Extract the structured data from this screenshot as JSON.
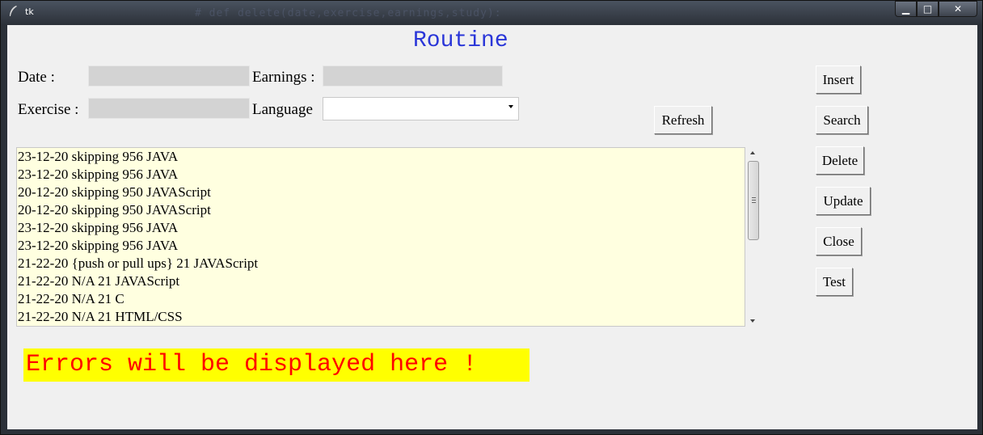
{
  "window": {
    "title": "tk",
    "background_hint": "# def delete(date,exercise,earnings,study):",
    "controls": {
      "minimize": "▁",
      "maximize": "□",
      "close": "✕"
    }
  },
  "app": {
    "heading": "Routine",
    "form": {
      "date_label": "Date :",
      "date_value": "",
      "earnings_label": "Earnings :",
      "earnings_value": "",
      "exercise_label": "Exercise :",
      "exercise_value": "",
      "language_label": "Language",
      "language_value": ""
    },
    "buttons": {
      "insert": "Insert",
      "search": "Search",
      "delete": "Delete",
      "update": "Update",
      "close": "Close",
      "test": "Test",
      "refresh": "Refresh"
    },
    "records": [
      "23-12-20 skipping 956 JAVA",
      "23-12-20 skipping 956 JAVA",
      "20-12-20 skipping 950 JAVAScript",
      "20-12-20 skipping 950 JAVAScript",
      "23-12-20 skipping 956 JAVA",
      "23-12-20 skipping 956 JAVA",
      "21-22-20 {push or pull ups} 21 JAVAScript",
      "21-22-20 N/A 21 JAVAScript",
      "21-22-20 N/A 21 C",
      "21-22-20 N/A 21 HTML/CSS"
    ],
    "error_message": "Errors will be displayed here !"
  },
  "colors": {
    "heading": "#2a36d8",
    "listbox_bg": "#ffffe0",
    "error_bg": "#ffff00",
    "error_text": "#ff0000",
    "entry_bg": "#d3d3d3"
  }
}
